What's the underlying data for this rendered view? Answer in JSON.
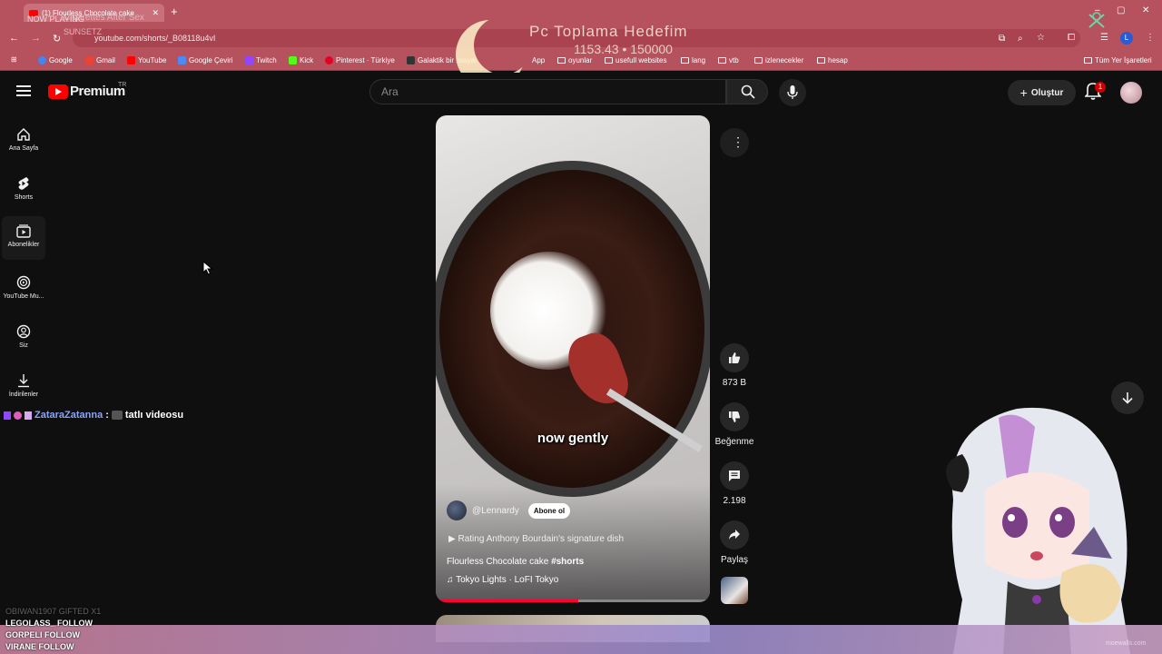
{
  "browser": {
    "tab_title": "(1) Flourless Chocolate cake",
    "new_tab": "+",
    "window_controls": [
      "–",
      "▢",
      "✕"
    ],
    "url": "youtube.com/shorts/_B08118u4vI",
    "bookmarks": [
      "Google",
      "Gmail",
      "YouTube",
      "Google Çeviri",
      "Twitch",
      "Kick",
      "Pinterest · Türkiye",
      "Galaktik bir sosyal",
      "App",
      "oyunlar",
      "usefull websites",
      "lang",
      "vtb",
      "izlenecekler",
      "hesap"
    ],
    "all_bookmarks": "Tüm Yer İşaretleri"
  },
  "stream": {
    "now_playing": "NOW PLAYING",
    "track_title": "Cigarettes After Sex",
    "track_sub": "SUNSETZ",
    "goal_title": "Pc Toplama Hedefim",
    "goal_value": "1153.43 • 150000",
    "alerts": [
      {
        "text": "OBIWAN1907 GIFTED X1",
        "faint": true
      },
      {
        "text": "LEGOLASS_  FOLLOW",
        "faint": false
      },
      {
        "text": "GORPELI  FOLLOW",
        "faint": false
      },
      {
        "text": "VIRANE  FOLLOW",
        "faint": false
      }
    ],
    "watermark": "moewalls.com"
  },
  "youtube": {
    "brand": "Premium",
    "region": "TR",
    "search_placeholder": "Ara",
    "create_label": "Oluştur",
    "notification_count": "1",
    "sidebar": [
      {
        "label": "Ana Sayfa",
        "icon": "home-icon"
      },
      {
        "label": "Shorts",
        "icon": "shorts-icon"
      },
      {
        "label": "Abonelikler",
        "icon": "subscriptions-icon"
      },
      {
        "label": "YouTube Mu...",
        "icon": "youtube-music-icon"
      },
      {
        "label": "Siz",
        "icon": "you-icon"
      },
      {
        "label": "İndirilenler",
        "icon": "download-icon"
      }
    ]
  },
  "chat": {
    "user": "ZataraZatanna",
    "separator": ":",
    "message": "tatlı videosu"
  },
  "short": {
    "caption": "now gently",
    "channel": "@Lennardy",
    "subscribe": "Abone ol",
    "related": "Rating Anthony Bourdain's signature dish",
    "title": "Flourless Chocolate cake",
    "hashtag": "#shorts",
    "music": "Tokyo Lights · LoFI Tokyo",
    "progress": 0.52,
    "likes": "873 B",
    "dislike_label": "Beğenme",
    "comments": "2.198",
    "share_label": "Paylaş"
  },
  "colors": {
    "browser_accent": "#b5525e",
    "yt_red": "#ff0000",
    "background": "#0f0f0f"
  }
}
